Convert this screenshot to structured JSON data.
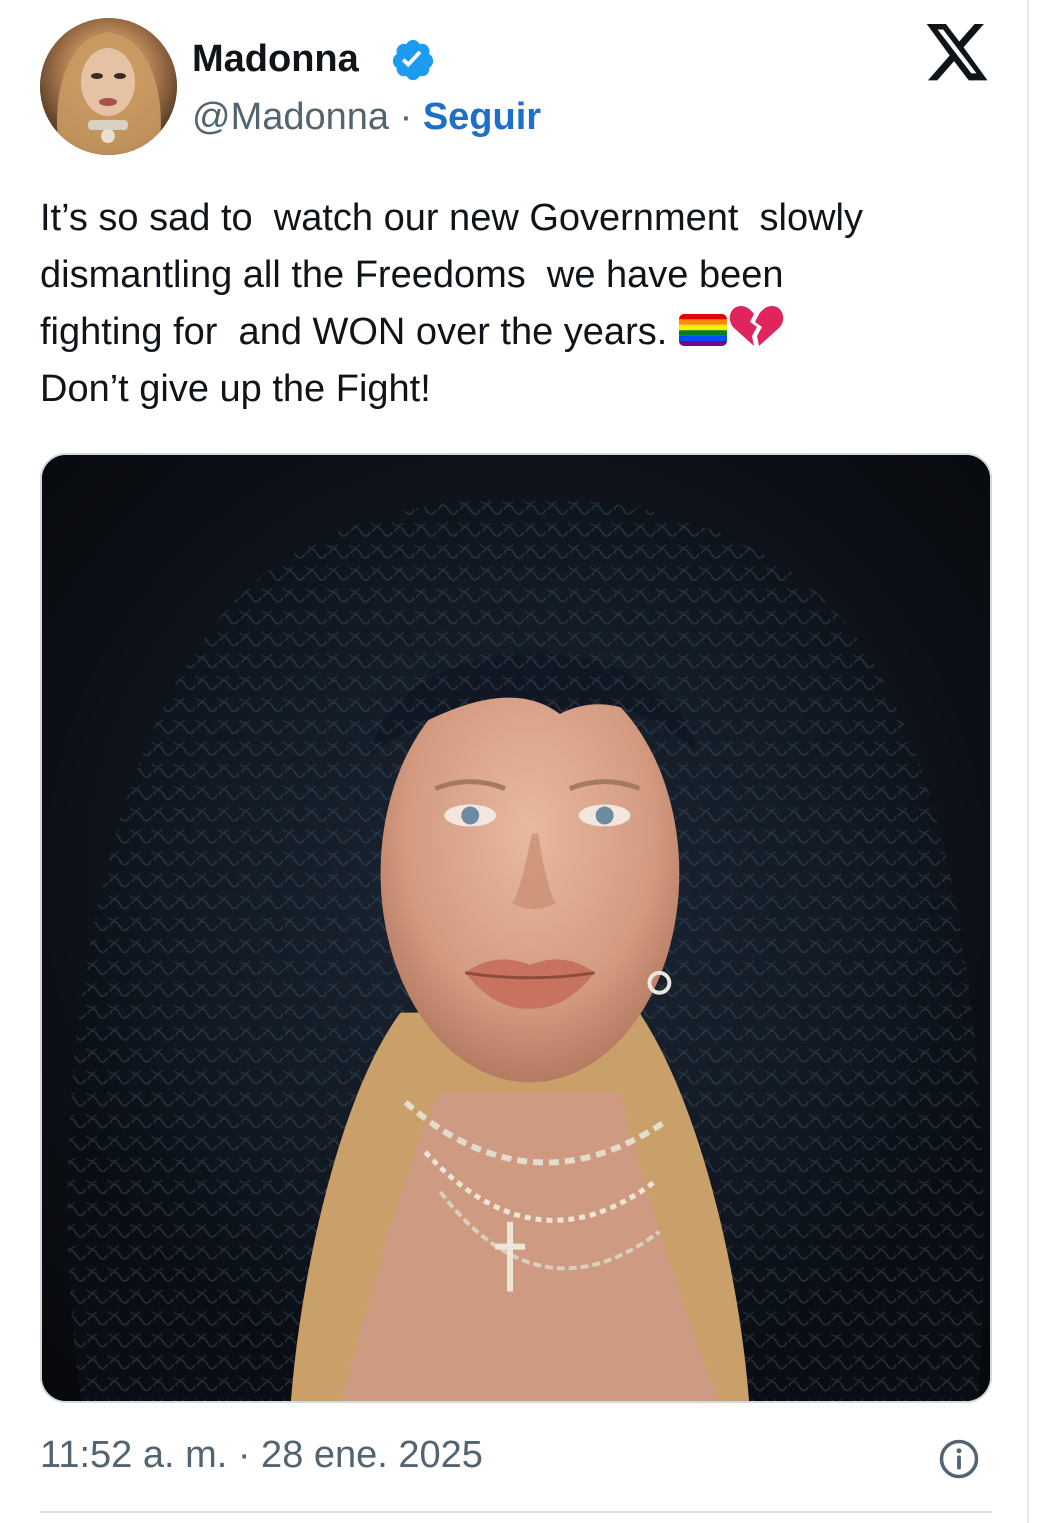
{
  "author": {
    "name": "Madonna",
    "handle": "@Madonna",
    "separator": "·",
    "follow_label": "Seguir",
    "verified_icon": "verified-badge-icon"
  },
  "brand": {
    "logo_icon": "x-logo-icon"
  },
  "tweet": {
    "line1": "It’s so sad to  watch our new Government  slowly",
    "line2": "dismantling all the Freedoms  we have been",
    "line3": "fighting for  and WON over the years. ",
    "line4": "Don’t give up the Fight!",
    "emojis": [
      "rainbow-flag-icon",
      "broken-heart-icon"
    ]
  },
  "media": {
    "type": "photo"
  },
  "footer": {
    "timestamp": "11:52 a. m. · 28 ene. 2025",
    "info_icon": "info-icon"
  },
  "colors": {
    "link": "#1d6fc7",
    "verified": "#1d9bf0",
    "muted": "#536471",
    "text": "#0f1419"
  }
}
